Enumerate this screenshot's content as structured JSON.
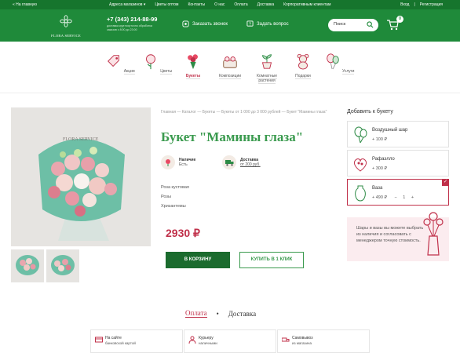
{
  "topbar": {
    "back": "« На главную",
    "nav": [
      "Адреса магазинов",
      "Цветы оптом",
      "Контакты",
      "О нас",
      "Оплата",
      "Доставка",
      "Корпоративным клиентам"
    ],
    "login": "Вход",
    "sep": "|",
    "register": "Регистрация"
  },
  "header": {
    "logo_text": "FLORA SERVICE",
    "phone": "+7 (343) 214-88-99",
    "phone_sub": "доставка круглосуточно обработка заказов с 8:00 до 23:00",
    "callback": "Заказать звонок",
    "question": "Задать вопрос",
    "search_placeholder": "Поиск",
    "cart_count": "0"
  },
  "categories": [
    {
      "label": "Акции",
      "icon": "tag-icon"
    },
    {
      "label": "Цветы",
      "icon": "flower-icon"
    },
    {
      "label": "Букеты",
      "icon": "bouquet-icon",
      "active": true
    },
    {
      "label": "Композиции",
      "icon": "basket-icon"
    },
    {
      "label": "Комнатные растения",
      "icon": "plant-icon"
    },
    {
      "label": "Подарки",
      "icon": "teddy-bear-icon"
    },
    {
      "label": "Услуги",
      "icon": "balloons-icon"
    }
  ],
  "product": {
    "breadcrumb": "Главная — Каталог — Букеты — Букеты от 1 000 до 3 000 рублей — Букет \"Мамины глаза\"",
    "title": "Букет \"Мамины глаза\"",
    "availability_label": "Наличие",
    "availability_value": "Есть",
    "delivery_label": "Доставка",
    "delivery_value": "от 200 руб.",
    "composition": [
      "Роза кустовая",
      "Розы",
      "Хризантемы"
    ],
    "price": "2930 ₽",
    "add_to_cart": "В КОРЗИНУ",
    "buy_one_click": "КУПИТЬ В 1 КЛИК",
    "gallery_watermark": "FLORA SERVICE"
  },
  "addons": {
    "title": "Добавить к букету",
    "items": [
      {
        "name": "Воздушный шар",
        "price": "+ 100 ₽",
        "icon": "balloon-icon"
      },
      {
        "name": "Рафаэлло",
        "price": "+ 300 ₽",
        "icon": "candy-box-icon"
      },
      {
        "name": "Ваза",
        "price": "+ 490 ₽",
        "qty": "1",
        "minus": "−",
        "plus": "+",
        "icon": "vase-icon",
        "checked": true
      }
    ],
    "promo": "Шары и вазы вы можете выбрать из наличия и согласовать с менеджером точную стоимость."
  },
  "tabs": {
    "payment": "Оплата",
    "bullet": "•",
    "delivery": "Доставка"
  },
  "delivery_options": [
    {
      "title": "На сайте",
      "sub": "банковской картой"
    },
    {
      "title": "Курьеру",
      "sub": "наличными"
    },
    {
      "title": "Самовывоз",
      "sub": "из магазина"
    }
  ],
  "colors": {
    "green": "#1f8a3a",
    "dark_green": "#16752d",
    "accent": "#c0304a"
  }
}
